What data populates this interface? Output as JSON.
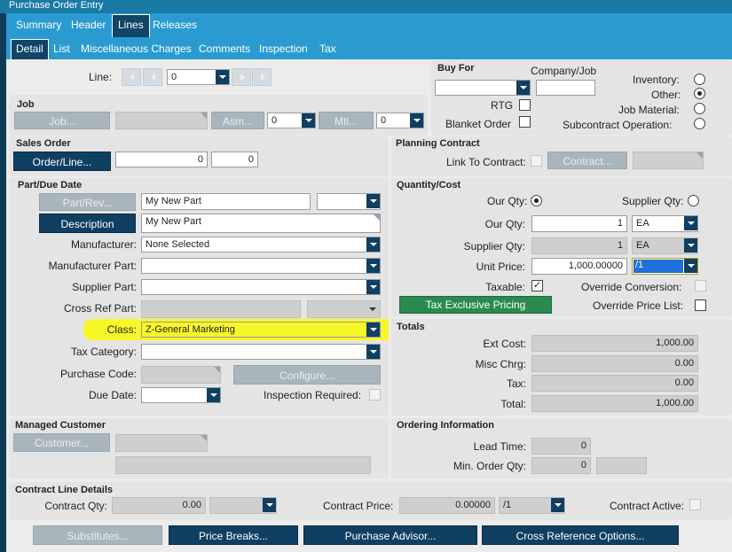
{
  "window": {
    "title": "Purchase Order Entry"
  },
  "tabs_main": [
    {
      "label": "Summary"
    },
    {
      "label": "Header"
    },
    {
      "label": "Lines"
    },
    {
      "label": "Releases"
    }
  ],
  "tabs_sub": [
    {
      "label": "Detail"
    },
    {
      "label": "List"
    },
    {
      "label": "Miscellaneous Charges"
    },
    {
      "label": "Comments"
    },
    {
      "label": "Inspection"
    },
    {
      "label": "Tax"
    }
  ],
  "line": {
    "label": "Line:",
    "value": "0"
  },
  "job": {
    "title": "Job",
    "job_button": "Job...",
    "asm_button": "Asm...",
    "asm_value": "0",
    "mtl_button": "Mtl...",
    "mtl_value": "0"
  },
  "buy_for": {
    "title": "Buy For",
    "company_job_label": "Company/Job",
    "rtg_label": "RTG",
    "blanket_label": "Blanket Order",
    "inventory_label": "Inventory:",
    "other_label": "Other:",
    "job_material_label": "Job Material:",
    "subcontract_label": "Subcontract Operation:",
    "selected": "other"
  },
  "sales_order": {
    "title": "Sales Order",
    "button": "Order/Line...",
    "order_value": "0",
    "line_value": "0"
  },
  "planning_contract": {
    "title": "Planning Contract",
    "link_label": "Link To Contract:",
    "contract_button": "Contract..."
  },
  "part": {
    "title": "Part/Due Date",
    "part_button": "Part/Rev...",
    "part_value": "My New Part",
    "description_button": "Description",
    "description_value": "My New Part",
    "manufacturer_label": "Manufacturer:",
    "manufacturer_value": "None Selected",
    "manufacturer_part_label": "Manufacturer Part:",
    "supplier_part_label": "Supplier Part:",
    "cross_ref_label": "Cross Ref Part:",
    "class_label": "Class:",
    "class_value": "Z-General Marketing",
    "tax_category_label": "Tax Category:",
    "purchase_code_label": "Purchase Code:",
    "configure_button": "Configure...",
    "due_date_label": "Due Date:",
    "inspection_label": "Inspection Required:"
  },
  "qty": {
    "title": "Quantity/Cost",
    "our_qty_radio": "Our Qty:",
    "supplier_qty_radio": "Supplier Qty:",
    "our_qty_label": "Our Qty:",
    "our_qty_value": "1",
    "our_uom": "EA",
    "supplier_qty_label": "Supplier Qty:",
    "supplier_qty_value": "1",
    "supplier_uom": "EA",
    "unit_price_label": "Unit Price:",
    "unit_price_value": "1,000.00000",
    "price_per": "/1",
    "taxable_label": "Taxable:",
    "taxable_mark": "✓",
    "override_conversion_label": "Override Conversion:",
    "tax_button": "Tax Exclusive Pricing",
    "override_price_label": "Override Price List:"
  },
  "totals": {
    "title": "Totals",
    "ext_cost_label": "Ext Cost:",
    "ext_cost": "1,000.00",
    "misc_label": "Misc Chrg:",
    "misc": "0.00",
    "tax_label": "Tax:",
    "tax": "0.00",
    "total_label": "Total:",
    "total": "1,000.00"
  },
  "managed_customer": {
    "title": "Managed Customer",
    "button": "Customer..."
  },
  "ordering": {
    "title": "Ordering Information",
    "lead_label": "Lead Time:",
    "lead_value": "0",
    "min_label": "Min. Order Qty:",
    "min_value": "0"
  },
  "contract_line": {
    "title": "Contract Line Details",
    "qty_label": "Contract Qty:",
    "qty_value": "0.00",
    "price_label": "Contract Price:",
    "price_value": "0.00000",
    "price_per": "/1",
    "active_label": "Contract Active:"
  },
  "bottom_buttons": {
    "substitutes": "Substitutes...",
    "price_breaks": "Price Breaks...",
    "purchase_advisor": "Purchase Advisor...",
    "cross_ref_options": "Cross Reference Options..."
  },
  "colors": {
    "accent": "#2a9bd1",
    "button": "#0f3f62",
    "highlight": "#f7f728",
    "green_button": "#2a8a50"
  }
}
